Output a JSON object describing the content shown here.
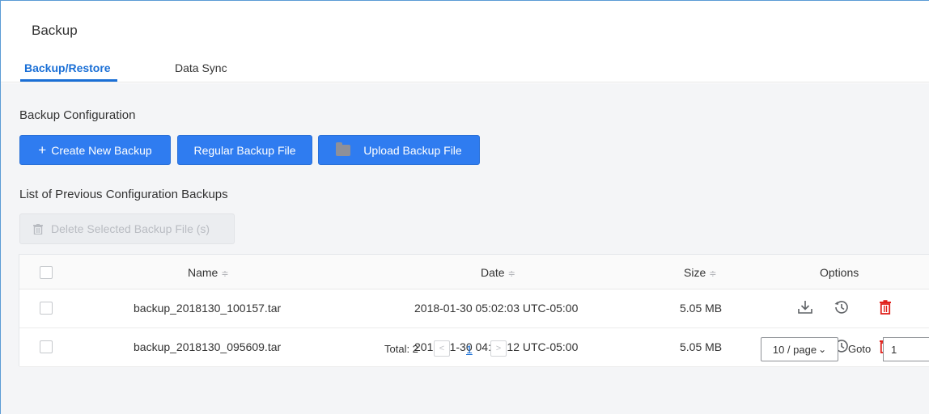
{
  "page_title": "Backup",
  "tabs": [
    {
      "label": "Backup/Restore",
      "active": true
    },
    {
      "label": "Data Sync",
      "active": false
    }
  ],
  "backup_configuration": {
    "title": "Backup Configuration",
    "buttons": {
      "create": {
        "icon": "+",
        "label": "Create New Backup"
      },
      "regular": "Regular Backup File",
      "upload": "Upload Backup File"
    }
  },
  "previous_backups": {
    "title": "List of Previous Configuration Backups",
    "delete_button": "Delete Selected Backup File (s)",
    "columns": {
      "name": "Name",
      "date": "Date",
      "size": "Size",
      "options": "Options"
    },
    "sort_glyph": "≑",
    "rows": [
      {
        "name": "backup_2018130_100157.tar",
        "date": "2018-01-30 05:02:03 UTC-05:00",
        "size": "5.05 MB"
      },
      {
        "name": "backup_2018130_095609.tar",
        "date": "2018-01-30 04:56:12 UTC-05:00",
        "size": "5.05 MB"
      }
    ],
    "row_option_icons": [
      "download-icon",
      "restore-history-icon",
      "delete-trash-icon"
    ]
  },
  "pagination": {
    "total": "Total: 2",
    "prev": "<",
    "current_page": "1",
    "next": ">",
    "page_size": "10 / page",
    "page_size_arrow": "⌄",
    "goto_label": "Goto",
    "goto_value": "1"
  },
  "colors": {
    "accent": "#2f7cf0",
    "tab_active": "#1a6fd6",
    "delete_red": "#e0211b",
    "icon_gray": "#5f6266",
    "frame_border": "#5b9bd5"
  }
}
